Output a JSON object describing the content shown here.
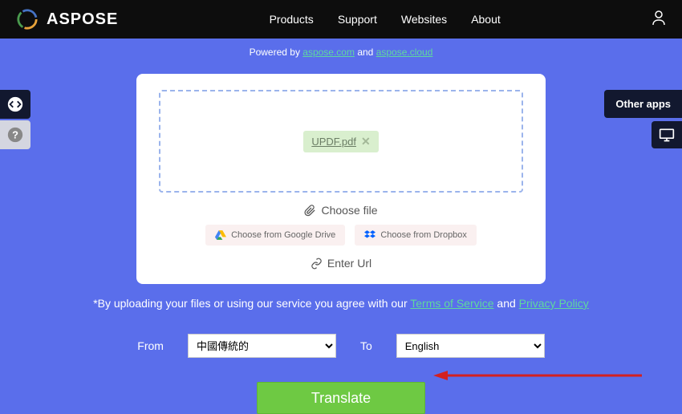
{
  "nav": {
    "brand": "ASPOSE",
    "items": [
      "Products",
      "Support",
      "Websites",
      "About"
    ]
  },
  "powered": {
    "prefix": "Powered by ",
    "link1": "aspose.com",
    "mid": " and ",
    "link2": "aspose.cloud"
  },
  "upload": {
    "file_name": "UPDF.pdf",
    "choose_file": "Choose file",
    "google_drive": "Choose from Google Drive",
    "dropbox": "Choose from Dropbox",
    "enter_url": "Enter Url"
  },
  "terms": {
    "prefix": "*By uploading your files or using our service you agree with our ",
    "tos": "Terms of Service",
    "mid": " and ",
    "privacy": "Privacy Policy"
  },
  "lang": {
    "from_label": "From",
    "from_value": "中國傳統的",
    "to_label": "To",
    "to_value": "English"
  },
  "translate_label": "Translate",
  "other_apps": "Other apps"
}
